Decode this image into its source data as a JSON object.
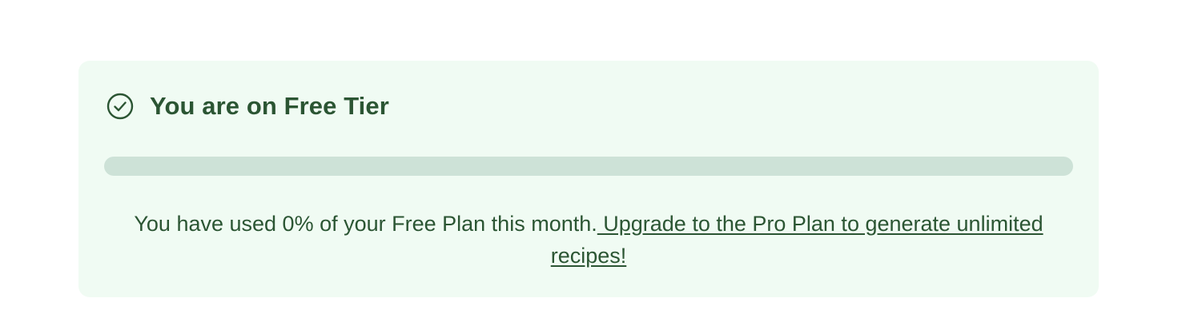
{
  "plan_card": {
    "icon": "check-circle-icon",
    "title": "You are on Free Tier",
    "usage_percent": 0,
    "usage_text": "You have used 0% of your Free Plan this month.",
    "upgrade_link": " Upgrade to the Pro Plan to generate unlimited recipes!",
    "colors": {
      "card_background": "#f0fbf3",
      "accent": "#2b5533",
      "progress_track": "#cde2d7"
    }
  }
}
